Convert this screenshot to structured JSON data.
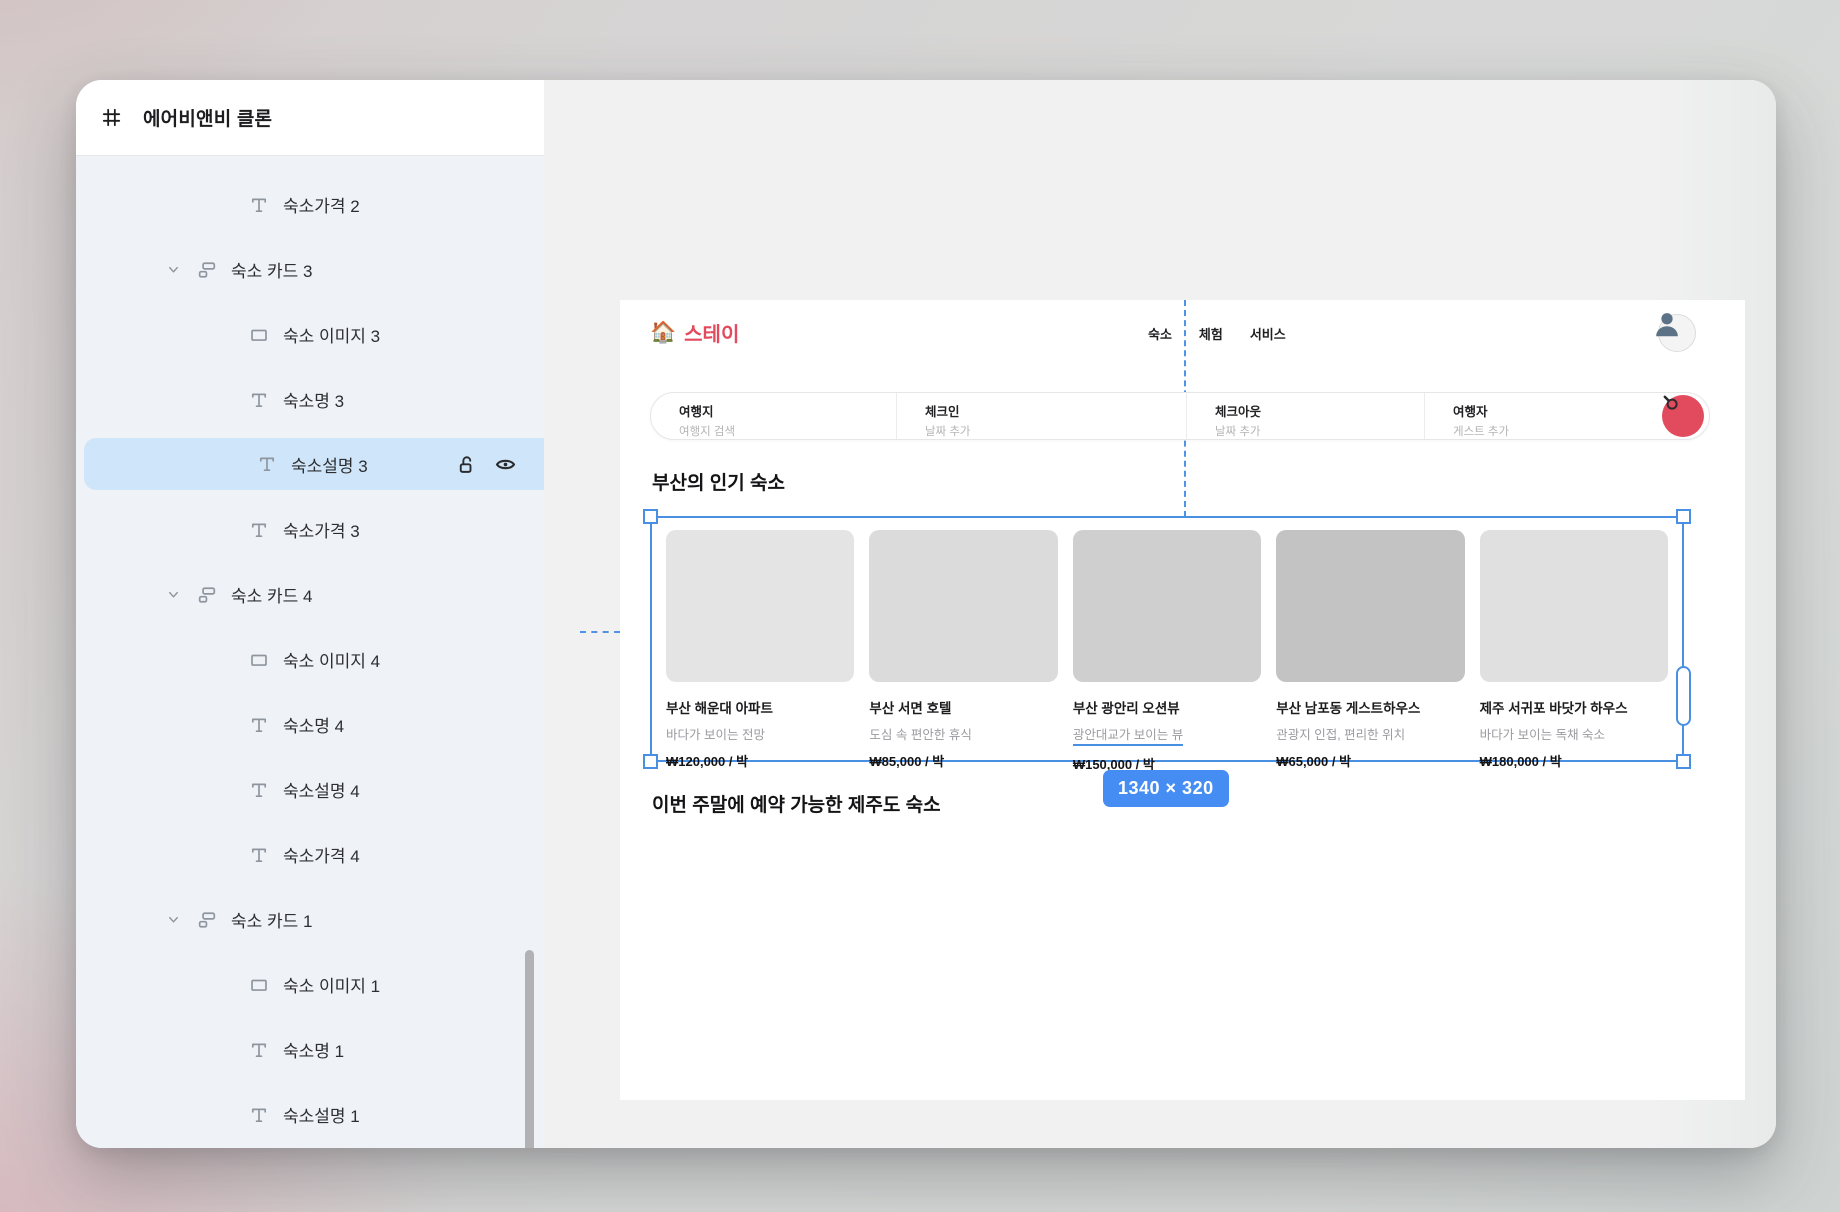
{
  "colors": {
    "accent_blue": "#4a90e2",
    "badge_blue": "#468df3",
    "brand_red": "#e14b5d",
    "selected_row_bg": "#cfe6fa"
  },
  "sidebar": {
    "title": "에어비앤비 클론",
    "layers": [
      {
        "label": "숙소가격 2",
        "type": "text",
        "indent": 2
      },
      {
        "label": "숙소 카드 3",
        "type": "group",
        "indent": 1,
        "expanded": true
      },
      {
        "label": "숙소 이미지 3",
        "type": "rect",
        "indent": 2
      },
      {
        "label": "숙소명 3",
        "type": "text",
        "indent": 2
      },
      {
        "label": "숙소설명 3",
        "type": "text",
        "indent": 2,
        "selected": true,
        "locked": false,
        "visible": true
      },
      {
        "label": "숙소가격 3",
        "type": "text",
        "indent": 2
      },
      {
        "label": "숙소 카드 4",
        "type": "group",
        "indent": 1,
        "expanded": true
      },
      {
        "label": "숙소 이미지 4",
        "type": "rect",
        "indent": 2
      },
      {
        "label": "숙소명 4",
        "type": "text",
        "indent": 2
      },
      {
        "label": "숙소설명 4",
        "type": "text",
        "indent": 2
      },
      {
        "label": "숙소가격 4",
        "type": "text",
        "indent": 2
      },
      {
        "label": "숙소 카드 1",
        "type": "group",
        "indent": 1,
        "expanded": true
      },
      {
        "label": "숙소 이미지 1",
        "type": "rect",
        "indent": 2
      },
      {
        "label": "숙소명 1",
        "type": "text",
        "indent": 2
      },
      {
        "label": "숙소설명 1",
        "type": "text",
        "indent": 2
      }
    ]
  },
  "canvas": {
    "frame_label": "에어비앤비 클론",
    "design": {
      "logo": {
        "emoji": "🏠",
        "text": "스테이"
      },
      "nav": [
        "숙소",
        "체험",
        "서비스"
      ],
      "search_fields": [
        {
          "label": "여행지",
          "placeholder": "여행지 검색"
        },
        {
          "label": "체크인",
          "placeholder": "날짜 추가"
        },
        {
          "label": "체크아웃",
          "placeholder": "날짜 추가"
        },
        {
          "label": "여행자",
          "placeholder": "게스트 추가"
        }
      ],
      "section1_title": "부산의 인기 숙소",
      "cards": [
        {
          "name": "부산 해운대 아파트",
          "desc": "바다가 보이는 전망",
          "price": "₩120,000 / 박",
          "shade": "#e4e4e4",
          "desc_selected": false
        },
        {
          "name": "부산 서면 호텔",
          "desc": "도심 속 편안한 휴식",
          "price": "₩85,000 / 박",
          "shade": "#dbdbdb",
          "desc_selected": false
        },
        {
          "name": "부산 광안리 오션뷰",
          "desc": "광안대교가 보이는 뷰",
          "price": "₩150,000 / 박",
          "shade": "#cfcfcf",
          "desc_selected": true
        },
        {
          "name": "부산 남포동 게스트하우스",
          "desc": "관광지 인접, 편리한 위치",
          "price": "₩65,000 / 박",
          "shade": "#c3c3c3",
          "desc_selected": false
        },
        {
          "name": "제주 서귀포 바닷가 하우스",
          "desc": "바다가 보이는 독채 숙소",
          "price": "₩180,000 / 박",
          "shade": "#e0e0e0",
          "desc_selected": false
        }
      ],
      "section2_title": "이번 주말에 예약 가능한 제주도 숙소",
      "selection_size_badge": "1340 × 320"
    }
  }
}
